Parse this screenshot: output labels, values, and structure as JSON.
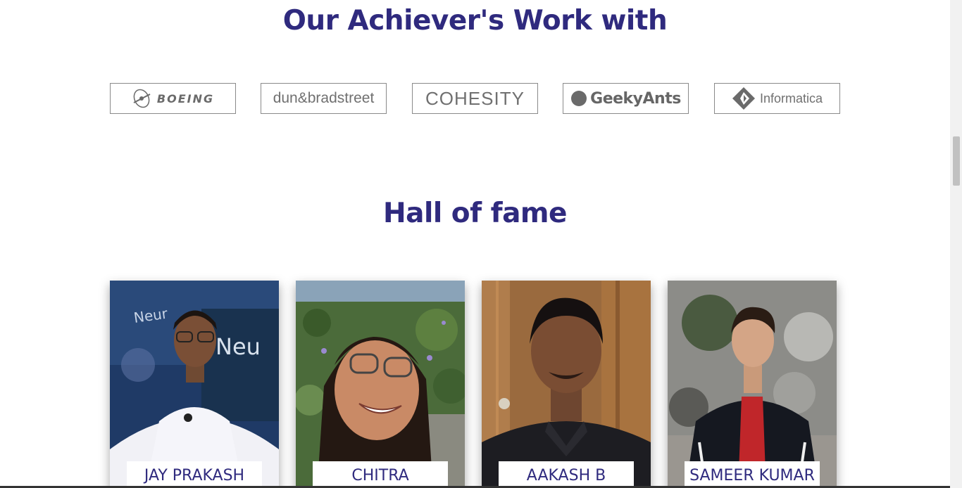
{
  "sections": {
    "companies_title": "Our Achiever's Work with",
    "hall_title": "Hall of fame"
  },
  "companies": [
    {
      "name": "BOEING",
      "icon": "boeing-logo"
    },
    {
      "name": "dun&bradstreet",
      "icon": "dnb-logo"
    },
    {
      "name": "COHESITY",
      "icon": "cohesity-logo"
    },
    {
      "name": "GeekyAnts",
      "icon": "geekyants-logo"
    },
    {
      "name": "Informatica",
      "icon": "informatica-logo"
    }
  ],
  "achievers": [
    {
      "name": "JAY PRAKASH"
    },
    {
      "name": "CHITRA"
    },
    {
      "name": "AAKASH B"
    },
    {
      "name": "SAMEER KUMAR"
    }
  ],
  "colors": {
    "heading": "#2f2a7e",
    "logo_border": "#8a8a8a",
    "logo_text": "#6a6a6a"
  }
}
